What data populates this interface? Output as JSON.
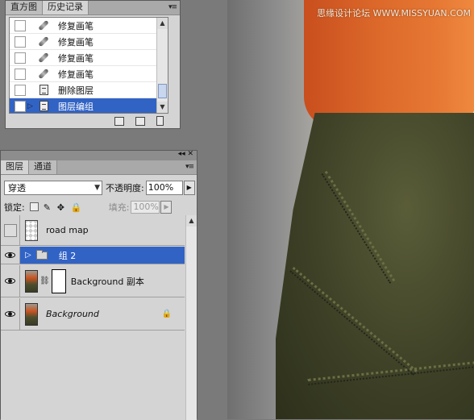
{
  "watermark": "思缘设计论坛 WWW.MISSYUAN.COM",
  "history_panel": {
    "tabs": [
      "直方图",
      "历史记录"
    ],
    "menu_icon": "panel-menu-icon",
    "rows": [
      {
        "label": "修复画笔",
        "icon": "healing-brush-icon"
      },
      {
        "label": "修复画笔",
        "icon": "healing-brush-icon"
      },
      {
        "label": "修复画笔",
        "icon": "healing-brush-icon"
      },
      {
        "label": "修复画笔",
        "icon": "healing-brush-icon"
      },
      {
        "label": "删除图层",
        "icon": "history-step-icon"
      },
      {
        "label": "图层编组",
        "icon": "history-step-icon",
        "selected": true
      }
    ],
    "footer_icons": [
      "new-document-from-state-icon",
      "new-snapshot-icon",
      "delete-icon"
    ]
  },
  "layers_panel": {
    "tabs": [
      "图层",
      "通道"
    ],
    "blend_mode": "穿透",
    "opacity_label": "不透明度:",
    "opacity_value": "100%",
    "lock_label": "锁定:",
    "fill_label": "填充:",
    "fill_value": "100%",
    "layers": [
      {
        "name": "road map",
        "visible": false,
        "type": "transparent"
      },
      {
        "name": "组 2",
        "visible": true,
        "type": "group",
        "selected": true
      },
      {
        "name": "Background 副本",
        "visible": true,
        "type": "masked"
      },
      {
        "name": "Background",
        "visible": true,
        "type": "background",
        "italic": true,
        "locked": true
      }
    ]
  },
  "colors": {
    "selection": "#3163c5",
    "panel_bg": "#d4d4d4",
    "shirt": "#dd6a2b",
    "skirt": "#3f4227"
  }
}
